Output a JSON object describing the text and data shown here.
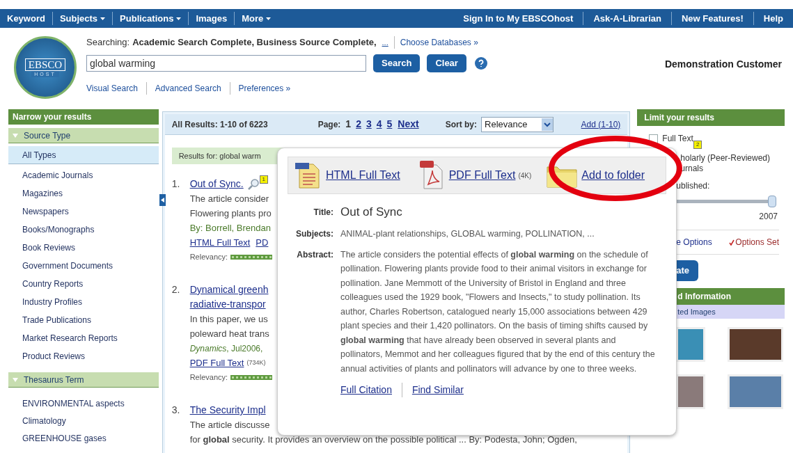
{
  "top_nav": {
    "left": [
      {
        "label": "Keyword",
        "has_menu": false
      },
      {
        "label": "Subjects",
        "has_menu": true
      },
      {
        "label": "Publications",
        "has_menu": true
      },
      {
        "label": "Images",
        "has_menu": false
      },
      {
        "label": "More",
        "has_menu": true
      }
    ],
    "right": [
      {
        "label": "Sign In to My EBSCOhost"
      },
      {
        "label": "Ask-A-Librarian"
      },
      {
        "label": "New Features!"
      },
      {
        "label": "Help"
      }
    ]
  },
  "logo": {
    "top": "EBSCO",
    "bottom": "HOST"
  },
  "search": {
    "searching_label": "Searching:",
    "databases": "Academic Search Complete, Business Source Complete,",
    "more_link": "...",
    "choose_link": "Choose Databases »",
    "value": "global warming",
    "buttons": [
      "Search",
      "Clear"
    ],
    "links": [
      "Visual Search",
      "Advanced Search",
      "Preferences »"
    ]
  },
  "user": "Demonstration Customer",
  "narrow": {
    "title": "Narrow your results",
    "groups": [
      {
        "title": "Source Type",
        "expanded": true,
        "items": [
          {
            "label": "All Types",
            "selected": true
          },
          {
            "label": "Academic Journals",
            "selected": false
          },
          {
            "label": "Magazines",
            "selected": false
          },
          {
            "label": "Newspapers",
            "selected": false
          },
          {
            "label": "Books/Monographs",
            "selected": false
          },
          {
            "label": "Book Reviews",
            "selected": false
          },
          {
            "label": "Government Documents",
            "selected": false
          },
          {
            "label": "Country Reports",
            "selected": false
          },
          {
            "label": "Industry Profiles",
            "selected": false
          },
          {
            "label": "Trade Publications",
            "selected": false
          },
          {
            "label": "Market Research Reports",
            "selected": false
          },
          {
            "label": "Product Reviews",
            "selected": false
          }
        ]
      },
      {
        "title": "Thesaurus Term",
        "expanded": true,
        "items": [
          {
            "label": "ENVIRONMENTAL aspects",
            "selected": false
          },
          {
            "label": "Climatology",
            "selected": false
          },
          {
            "label": "GREENHOUSE gases",
            "selected": false
          }
        ]
      }
    ]
  },
  "results_bar": {
    "summary": "All Results: 1-10 of 6223",
    "page_label": "Page:",
    "pages": [
      {
        "label": "1",
        "selected": true
      },
      {
        "label": "2",
        "selected": false
      },
      {
        "label": "3",
        "selected": false
      },
      {
        "label": "4",
        "selected": false
      },
      {
        "label": "5",
        "selected": false
      }
    ],
    "next": "Next",
    "sort_label": "Sort by:",
    "sort_value": "Relevance",
    "add_link": "Add (1-10)"
  },
  "results_for": "Results for: global warm",
  "results": [
    {
      "number": "1.",
      "title_lines": [
        "Out of Sync."
      ],
      "badge": "1",
      "lines": [
        {
          "kind": "text",
          "text": "The article consider"
        },
        {
          "kind": "text",
          "text": "Flowering plants pro"
        },
        {
          "kind": "byline",
          "text": "By: Borrell, Brendan"
        },
        {
          "kind": "links",
          "links": [
            {
              "label": "HTML Full Text"
            },
            {
              "label": "PD"
            }
          ]
        },
        {
          "kind": "relevancy",
          "text": "Relevancy:"
        }
      ]
    },
    {
      "number": "2.",
      "title_lines": [
        "Dynamical greenh",
        "radiative-transpor"
      ],
      "lines": [
        {
          "kind": "text",
          "text": "In this paper, we us"
        },
        {
          "kind": "text",
          "text": "poleward heat trans"
        },
        {
          "kind": "source",
          "text": "*Dynamics*, Jul2006,"
        },
        {
          "kind": "links",
          "links": [
            {
              "label": "PDF Full Text",
              "size": "(734K)"
            }
          ]
        },
        {
          "kind": "relevancy",
          "text": "Relevancy:"
        }
      ]
    },
    {
      "number": "3.",
      "title_lines": [
        "The Security Impl"
      ],
      "lines": [
        {
          "kind": "text",
          "text": "The article discusse"
        },
        {
          "kind": "text",
          "text": "for **global** security. It provides an overview on the possible political ... By: Podesta, John; Ogden,"
        }
      ]
    }
  ],
  "preview": {
    "links": [
      {
        "kind": "html",
        "label": "HTML Full Text"
      },
      {
        "kind": "pdf",
        "label": "PDF Full Text",
        "size": "(4K)"
      },
      {
        "kind": "folder",
        "label": "Add to folder"
      }
    ],
    "fields": [
      {
        "kind": "title",
        "label": "Title:",
        "value": "Out of Sync"
      },
      {
        "kind": "text",
        "label": "Subjects:",
        "value": "ANIMAL-plant relationships, GLOBAL warming, POLLINATION, ..."
      },
      {
        "kind": "text",
        "label": "Abstract:",
        "value": "The article considers the potential effects of **global warming** on the schedule of pollination. Flowering plants provide food to their animal visitors in exchange for pollination. Jane Memmott of the University of Bristol in England and three colleagues used the 1929 book, \"Flowers and Insects,\" to study pollination. Its author, Charles Robertson, catalogued nearly 15,000 associations between 429 plant species and their 1,420 pollinators. On the basis of timing shifts caused by **global warming** that have already been observed in several plants and pollinators, Memmot and her colleagues figured that by the end of this century the annual activities of plants and pollinators will advance by one to three weeks."
      }
    ],
    "footer_links": [
      "Full Citation",
      "Find Similar"
    ]
  },
  "limit": {
    "title": "Limit your results",
    "full_text": {
      "label": "Full Text",
      "checked": false,
      "badge": "2"
    },
    "partial_lines": [
      "holarly (Peer-Reviewed)",
      "urnals"
    ],
    "date_label": "ublished:",
    "slider": {
      "level": 1
    },
    "slider_value": "2007",
    "options_link": "e Options",
    "options_set": "Options Set",
    "update_button": "ate"
  },
  "related": {
    "title": "d Information",
    "subtitle": "ted Images"
  }
}
